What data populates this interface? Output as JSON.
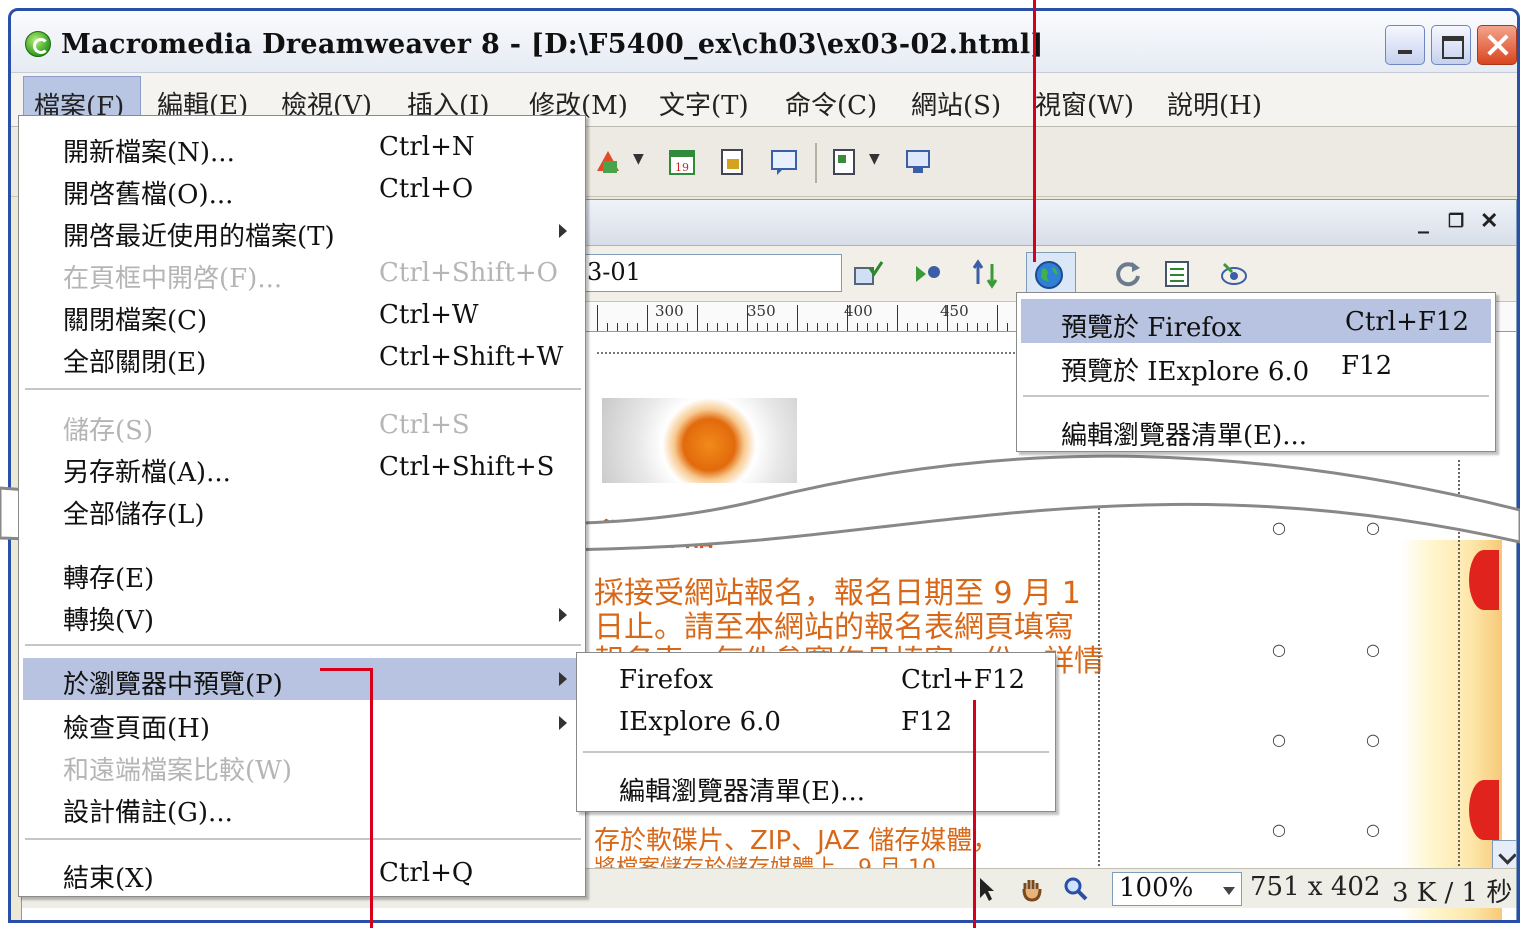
{
  "window": {
    "title": "Macromedia Dreamweaver 8 - [D:\\F5400_ex\\ch03\\ex03-02.html]"
  },
  "menubar": {
    "items": [
      "檔案(F)",
      "編輯(E)",
      "檢視(V)",
      "插入(I)",
      "修改(M)",
      "文字(T)",
      "命令(C)",
      "網站(S)",
      "視窗(W)",
      "說明(H)"
    ]
  },
  "file_menu": {
    "items": [
      {
        "label": "開新檔案(N)...",
        "shortcut": "Ctrl+N"
      },
      {
        "label": "開啓舊檔(O)...",
        "shortcut": "Ctrl+O"
      },
      {
        "label": "開啓最近使用的檔案(T)",
        "shortcut": ""
      },
      {
        "label": "在頁框中開啓(F)...",
        "shortcut": "Ctrl+Shift+O"
      },
      {
        "label": "關閉檔案(C)",
        "shortcut": "Ctrl+W"
      },
      {
        "label": "全部關閉(E)",
        "shortcut": "Ctrl+Shift+W"
      },
      {
        "label": "儲存(S)",
        "shortcut": "Ctrl+S"
      },
      {
        "label": "另存新檔(A)...",
        "shortcut": "Ctrl+Shift+S"
      },
      {
        "label": "全部儲存(L)",
        "shortcut": ""
      },
      {
        "label": "轉存(E)",
        "shortcut": ""
      },
      {
        "label": "轉換(V)",
        "shortcut": ""
      },
      {
        "label": "於瀏覽器中預覽(P)",
        "shortcut": ""
      },
      {
        "label": "檢查頁面(H)",
        "shortcut": ""
      },
      {
        "label": "和遠端檔案比較(W)",
        "shortcut": ""
      },
      {
        "label": "設計備註(G)...",
        "shortcut": ""
      },
      {
        "label": "結束(X)",
        "shortcut": "Ctrl+Q"
      }
    ]
  },
  "preview_submenu": {
    "items": [
      {
        "label": "Firefox",
        "shortcut": "Ctrl+F12"
      },
      {
        "label": "IExplore 6.0",
        "shortcut": "F12"
      },
      {
        "label": "編輯瀏覽器清單(E)...",
        "shortcut": ""
      }
    ]
  },
  "globe_menu": {
    "items": [
      {
        "label": "預覽於 Firefox",
        "shortcut": "Ctrl+F12"
      },
      {
        "label": "預覽於 IExplore 6.0",
        "shortcut": "F12"
      },
      {
        "label": "編輯瀏覽器清單(E)...",
        "shortcut": ""
      }
    ]
  },
  "document": {
    "title_value": "3-01",
    "ruler": [
      "300",
      "350",
      "400",
      "450"
    ],
    "content_lines": [
      "參賽作品",
      "採接受網站報名，報名日期至 9 月 1",
      "日止。請至本網站的報名表網頁填寫",
      "報名表，每件參賽作品填寫一份，詳情",
      "存於軟碟片、ZIP、JAZ 儲存媒體，",
      "將檔案儲存於儲存媒體上，9 月 10"
    ]
  },
  "statusbar": {
    "zoom": "100%",
    "size": "751 x 402",
    "download": "3 K / 1 秒"
  }
}
